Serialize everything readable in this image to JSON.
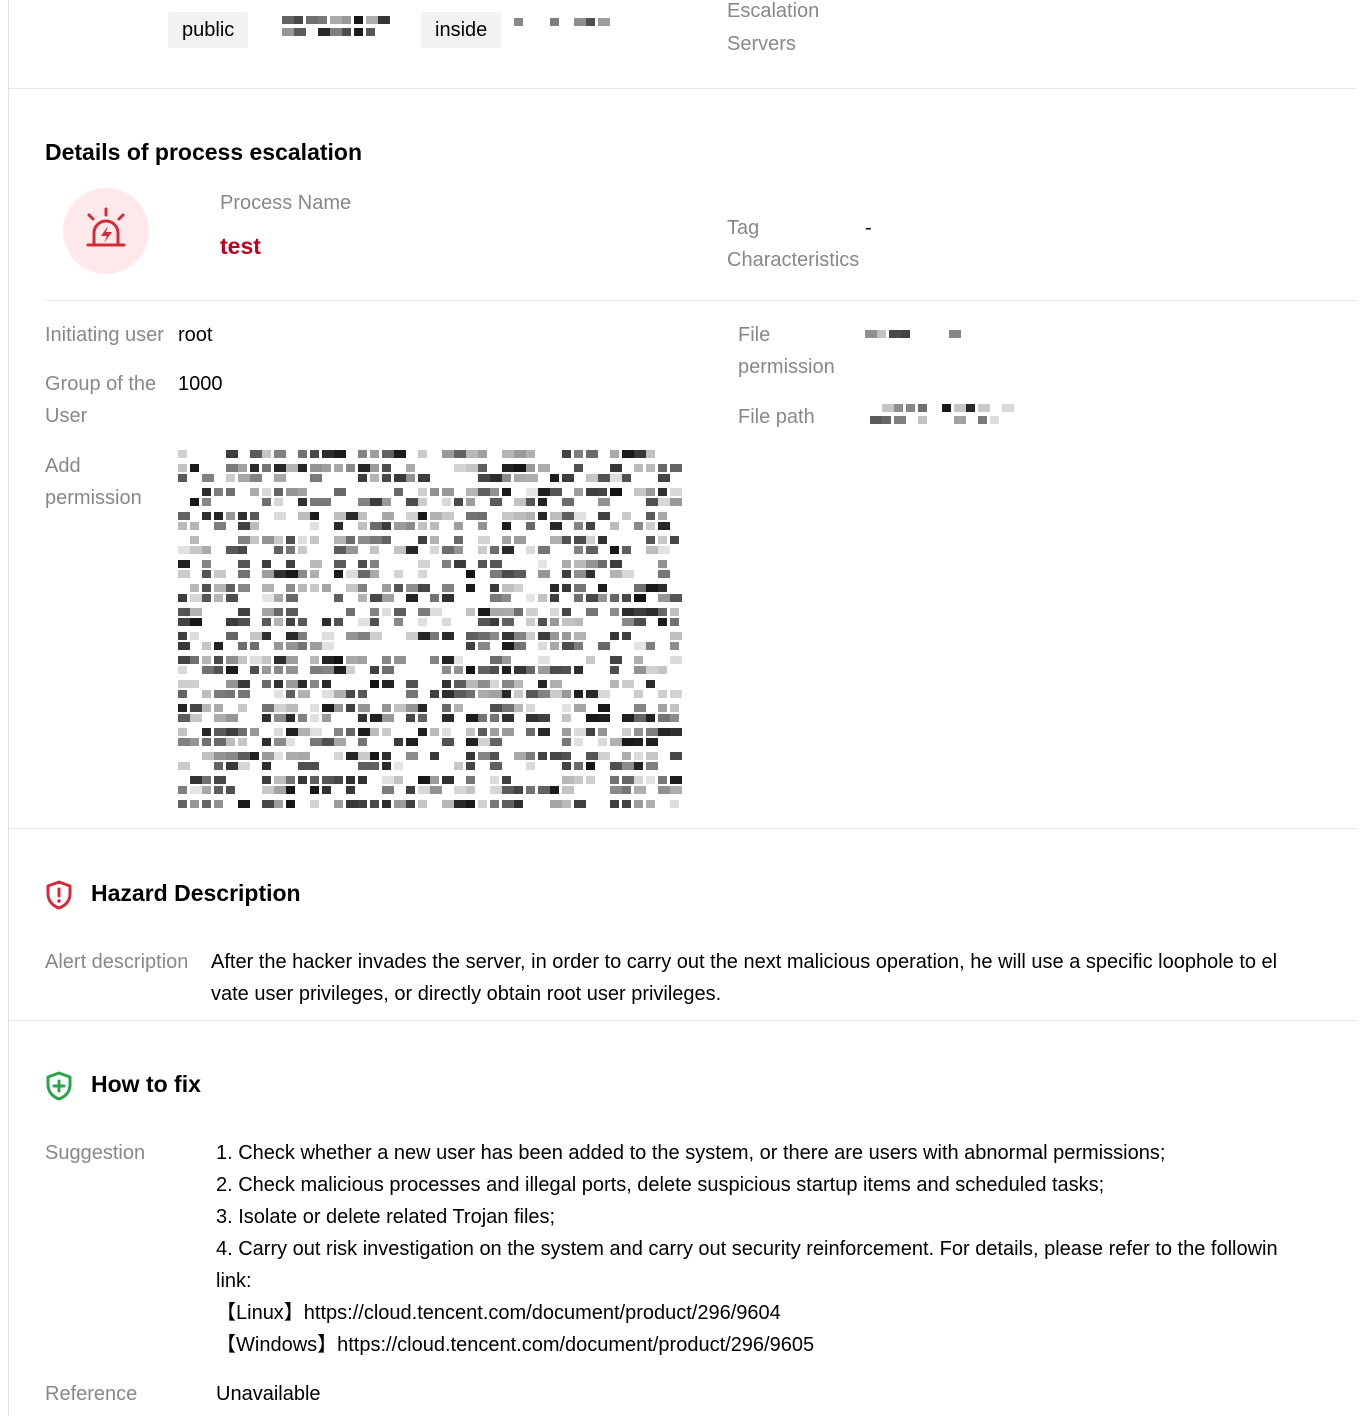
{
  "top": {
    "tags": [
      "public",
      "inside"
    ],
    "escalation_label_line1": "Escalation",
    "escalation_label_line2": "Servers"
  },
  "process_section": {
    "title": "Details of process escalation",
    "process_name_label": "Process Name",
    "process_name": "test",
    "tag_label_line1": "Tag",
    "tag_label_line2": "Characteristics",
    "tag_value": "-"
  },
  "details": {
    "initiating_user_label": "Initiating user",
    "initiating_user": "root",
    "group_label_line1": "Group of the",
    "group_label_line2": "User",
    "group_value": "1000",
    "add_permission_label_line1": "Add",
    "add_permission_label_line2": "permission",
    "file_permission_label_line1": "File",
    "file_permission_label_line2": "permission",
    "file_path_label": "File path"
  },
  "hazard": {
    "title": "Hazard Description",
    "alert_label": "Alert description",
    "alert_line1": "After the hacker invades the server, in order to carry out the next malicious operation, he will use a specific loophole to el",
    "alert_line2": "vate user privileges, or directly obtain root user privileges."
  },
  "fix": {
    "title": "How to fix",
    "suggestion_label": "Suggestion",
    "lines": [
      "1. Check whether a new user has been added to the system, or there are users with abnormal permissions;",
      "2. Check malicious processes and illegal ports, delete suspicious startup items and scheduled tasks;",
      "3. Isolate or delete related Trojan files;",
      "4. Carry out risk investigation on the system and carry out security reinforcement. For details, please refer to the followin",
      "link:",
      "【Linux】https://cloud.tencent.com/document/product/296/9604",
      "【Windows】https://cloud.tencent.com/document/product/296/9605"
    ],
    "reference_label": "Reference",
    "reference_value": "Unavailable"
  },
  "colors": {
    "process_name": "#c0001c",
    "hazard_icon": "#d42a3a",
    "fix_icon": "#2aa44b",
    "label_gray": "#888888"
  },
  "icons": {
    "alarm": "alarm-icon",
    "hazard": "shield-alert-icon",
    "fix": "shield-plus-icon"
  }
}
